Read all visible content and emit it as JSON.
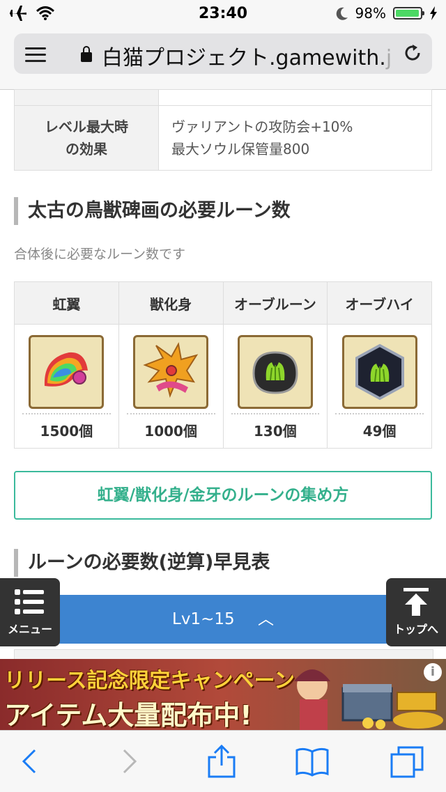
{
  "status_bar": {
    "time": "23:40",
    "battery_percent": "98%",
    "battery_level": 0.98,
    "icons": [
      "airplane-icon",
      "wifi-icon",
      "moon-icon",
      "battery-icon",
      "charging-icon"
    ]
  },
  "browser": {
    "url_text": "白猫プロジェクト.gamewith.",
    "url_fade": "j"
  },
  "info_table": {
    "row_label_line1": "レベル最大時",
    "row_label_line2": "の効果",
    "row_value_line1": "ヴァリアントの攻防会+10%",
    "row_value_line2": "最大ソウル保管量800"
  },
  "section1": {
    "heading": "太古の鳥獣碑画の必要ルーン数",
    "note": "合体後に必要なルーン数です"
  },
  "rune_table": {
    "headers": [
      "虹翼",
      "獣化身",
      "オーブルーン",
      "オーブハイ"
    ],
    "counts": [
      "1500個",
      "1000個",
      "130個",
      "49個"
    ]
  },
  "guide_button": "虹翼/獣化身/金牙のルーンの集め方",
  "section2": {
    "heading": "ルーンの必要数(逆算)早見表"
  },
  "level_bar": {
    "label": "Lv1~15",
    "caret": "︿"
  },
  "menu_button": "メニュー",
  "top_button": "トップへ",
  "ad": {
    "line1": "リリース記念限定キャンペーン",
    "line2": "アイテム大量配布中!",
    "info_glyph": "i"
  },
  "colors": {
    "accent_green": "#3bba9c",
    "bar_blue": "#3d84d0",
    "frame_gold": "#8b6a35"
  }
}
